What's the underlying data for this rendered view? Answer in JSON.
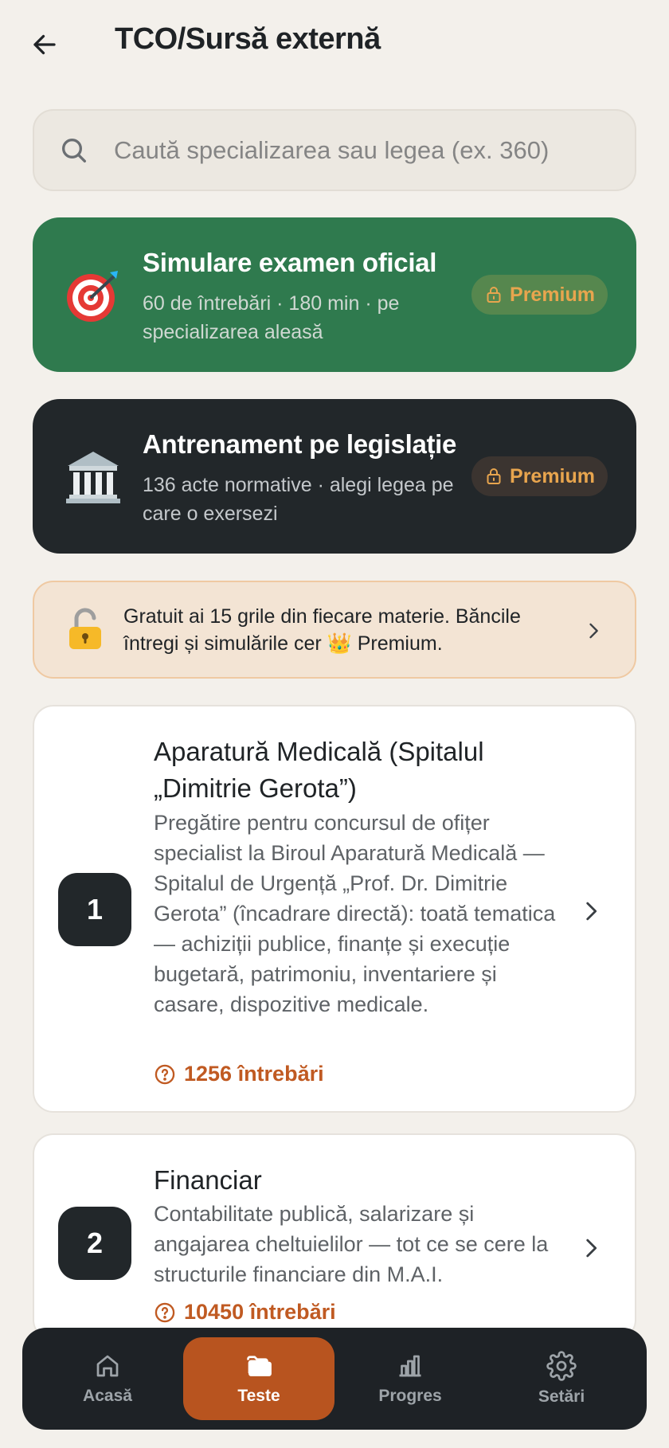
{
  "header": {
    "title": "TCO/Sursă externă"
  },
  "search": {
    "placeholder": "Caută specializarea sau legea (ex. 360)"
  },
  "promos": [
    {
      "emoji": "🎯",
      "title": "Simulare examen oficial",
      "subtitle": "60 de întrebări · 180 min · pe specializarea aleasă",
      "badge": "Premium",
      "color": "#2f7a4e"
    },
    {
      "emoji": "🏛️",
      "title": "Antrenament pe legislație",
      "subtitle": "136 acte normative · alegi legea pe care o exersezi",
      "badge": "Premium",
      "color": "#22272a"
    }
  ],
  "banner": {
    "icon": "🔓",
    "text": "Gratuit ai 15 grile din fiecare materie. Băncile întregi și simulările cer 👑 Premium."
  },
  "specializations": [
    {
      "number": "1",
      "title": "Aparatură Medicală (Spitalul „Dimitrie Gerota”)",
      "description": "Pregătire pentru concursul de ofițer specialist la Biroul Aparatură Medicală — Spitalul de Urgență „Prof. Dr. Dimitrie Gerota” (încadrare directă): toată tematica — achiziții publice, finanțe și execuție bugetară, patrimoniu, inventariere și casare, dispozitive medicale.",
      "questions": "1256 întrebări"
    },
    {
      "number": "2",
      "title": "Financiar",
      "description": "Contabilitate publică, salarizare și angajarea cheltuielilor — tot ce se cere la structurile financiare din M.A.I.",
      "questions": "10450 întrebări"
    }
  ],
  "nav": {
    "items": [
      {
        "label": "Acasă",
        "icon": "home-icon"
      },
      {
        "label": "Teste",
        "icon": "folder-icon"
      },
      {
        "label": "Progres",
        "icon": "bar-chart-icon"
      },
      {
        "label": "Setări",
        "icon": "gear-icon"
      }
    ],
    "active_index": 1,
    "active_color": "#b8541f"
  }
}
